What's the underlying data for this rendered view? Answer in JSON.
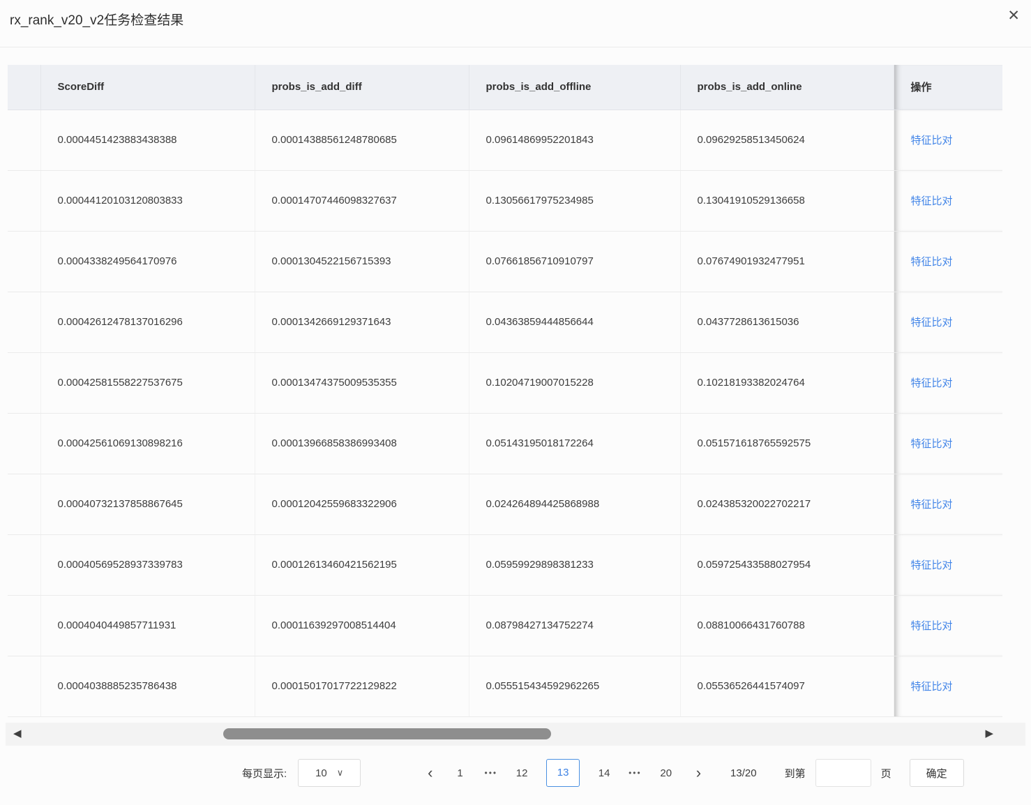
{
  "modal": {
    "title": "rx_rank_v20_v2任务检查结果"
  },
  "icons": {
    "close": "✕",
    "select_caret": "∨",
    "prev": "‹",
    "next": "›",
    "scroll_left": "◀",
    "scroll_right": "▶"
  },
  "table": {
    "columns": [
      "",
      "ScoreDiff",
      "probs_is_add_diff",
      "probs_is_add_offline",
      "probs_is_add_online",
      "操作"
    ],
    "action_label": "特征比对",
    "rows": [
      [
        "0.0004451423883438388",
        "0.00014388561248780685",
        "0.09614869952201843",
        "0.09629258513450624"
      ],
      [
        "0.00044120103120803833",
        "0.00014707446098327637",
        "0.13056617975234985",
        "0.13041910529136658"
      ],
      [
        "0.0004338249564170976",
        "0.0001304522156715393",
        "0.07661856710910797",
        "0.07674901932477951"
      ],
      [
        "0.00042612478137016296",
        "0.0001342669129371643",
        "0.04363859444856644",
        "0.0437728613615036"
      ],
      [
        "0.00042581558227537675",
        "0.00013474375009535355",
        "0.10204719007015228",
        "0.10218193382024764"
      ],
      [
        "0.00042561069130898216",
        "0.00013966858386993408",
        "0.05143195018172264",
        "0.051571618765592575"
      ],
      [
        "0.00040732137858867645",
        "0.00012042559683322906",
        "0.024264894425868988",
        "0.024385320022702217"
      ],
      [
        "0.00040569528937339783",
        "0.00012613460421562195",
        "0.05959929898381233",
        "0.059725433588027954"
      ],
      [
        "0.0004040449857711931",
        "0.00011639297008514404",
        "0.08798427134752274",
        "0.08810066431760788"
      ],
      [
        "0.0004038885235786438",
        "0.00015017017722129822",
        "0.055515434592962265",
        "0.05536526441574097"
      ]
    ]
  },
  "pagination": {
    "per_page_label": "每页显示:",
    "per_page_value": "10",
    "pages": [
      {
        "label": "1",
        "type": "page"
      },
      {
        "label": "•••",
        "type": "ellipsis"
      },
      {
        "label": "12",
        "type": "page"
      },
      {
        "label": "13",
        "type": "page",
        "active": true
      },
      {
        "label": "14",
        "type": "page"
      },
      {
        "label": "•••",
        "type": "ellipsis"
      },
      {
        "label": "20",
        "type": "page"
      }
    ],
    "page_indicator": "13/20",
    "goto_label": "到第",
    "goto_suffix": "页",
    "goto_value": "",
    "confirm_label": "确定"
  },
  "colors": {
    "link_blue": "#4285e8",
    "active_page_blue": "#4a90e2",
    "header_bg": "#eef0f4",
    "row_border": "#ebebeb",
    "scroll_thumb": "#8e8e8e",
    "text": "#3d3d3d"
  }
}
